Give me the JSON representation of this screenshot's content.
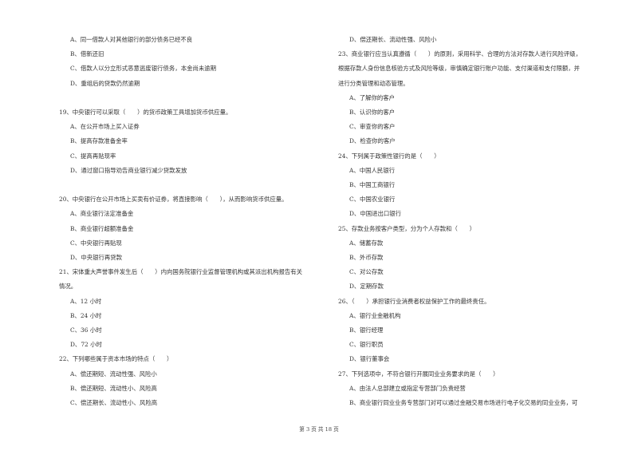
{
  "left_column": {
    "q18_options": [
      "A、同一借款人对其他银行的部分债务已经不良",
      "B、借新还旧",
      "C、借款人以分立形式恶意逃废银行债务，本金尚未逾期",
      "D、重组后的贷款仍然逾期"
    ],
    "q19": {
      "stem": "19、中央银行可以采取（　　）的货币政策工具增加货币供应量。",
      "options": [
        "A、在公开市场上买入证券",
        "B、提高存款准备金率",
        "C、提高再贴现率",
        "D、通过窗口指导劝告商业银行减少贷款发放"
      ]
    },
    "q20": {
      "stem": "20、中央银行在公开市场上买卖有价证券，将直接影响（　　），从而影响货币供应量。",
      "options": [
        "A、商业银行法定准备金",
        "B、商业银行超额准备金",
        "C、中央银行再贴现",
        "D、中央银行再贷款"
      ]
    },
    "q21": {
      "stem_line1": "21、宋体重大声誉事件发生后（　　）内向国务院银行业监督管理机构或其派出机构报告有关",
      "stem_line2": "情况。",
      "options": [
        "A、12 小时",
        "B、24 小时",
        "C、36 小时",
        "D、72 小时"
      ]
    },
    "q22": {
      "stem": "22、下列哪些属于资本市场的特点（　　）",
      "options": [
        "A、偿还期短、流动性强、风险小",
        "B、偿还期短、流动性小、风险高",
        "C、偿还期长、流动性小、风险高"
      ]
    }
  },
  "right_column": {
    "q22_option_d": "D、偿还期长、流动性强、风险小",
    "q23": {
      "stem_line1": "23、商业银行应当认真遵循（　　）的原则，采用科学、合理的方法对存款人进行风险评级，",
      "stem_line2": "根据存款人身份信息核验方式及风险等级，审慎确定银行账户功能、支付渠道和支付限额，并",
      "stem_line3": "进行分类管理和动态管理。",
      "options": [
        "A、了解你的客户",
        "B、认识你的客户",
        "C、审查你的客户",
        "D、检查你的客户"
      ]
    },
    "q24": {
      "stem": "24、下列属于政策性银行的是（　　）",
      "options": [
        "A、中国人民银行",
        "B、中国工商银行",
        "C、中国农业银行",
        "D、中国进出口银行"
      ]
    },
    "q25": {
      "stem": "25、存款业务按客户类型，分为个人存款和（　　）",
      "options": [
        "A、储蓄存款",
        "B、外币存款",
        "C、对公存款",
        "D、定期存款"
      ]
    },
    "q26": {
      "stem": "26、（　　）承担银行业消费者权益保护工作的最终责任。",
      "options": [
        "A、银行业金融机构",
        "B、银行经理",
        "C、银行职员",
        "D、银行董事会"
      ]
    },
    "q27": {
      "stem": "27、下列选项中，不符合银行开展同业业务要求的是（　　）",
      "options": [
        "A、由法人总部建立或指定专营部门负责经营",
        "B、商业银行同业业务专营部门对可以通过金融交易市场进行电子化交易的同业业务，可"
      ]
    }
  },
  "footer": {
    "page_label": "第 3 页 共 18 页"
  }
}
